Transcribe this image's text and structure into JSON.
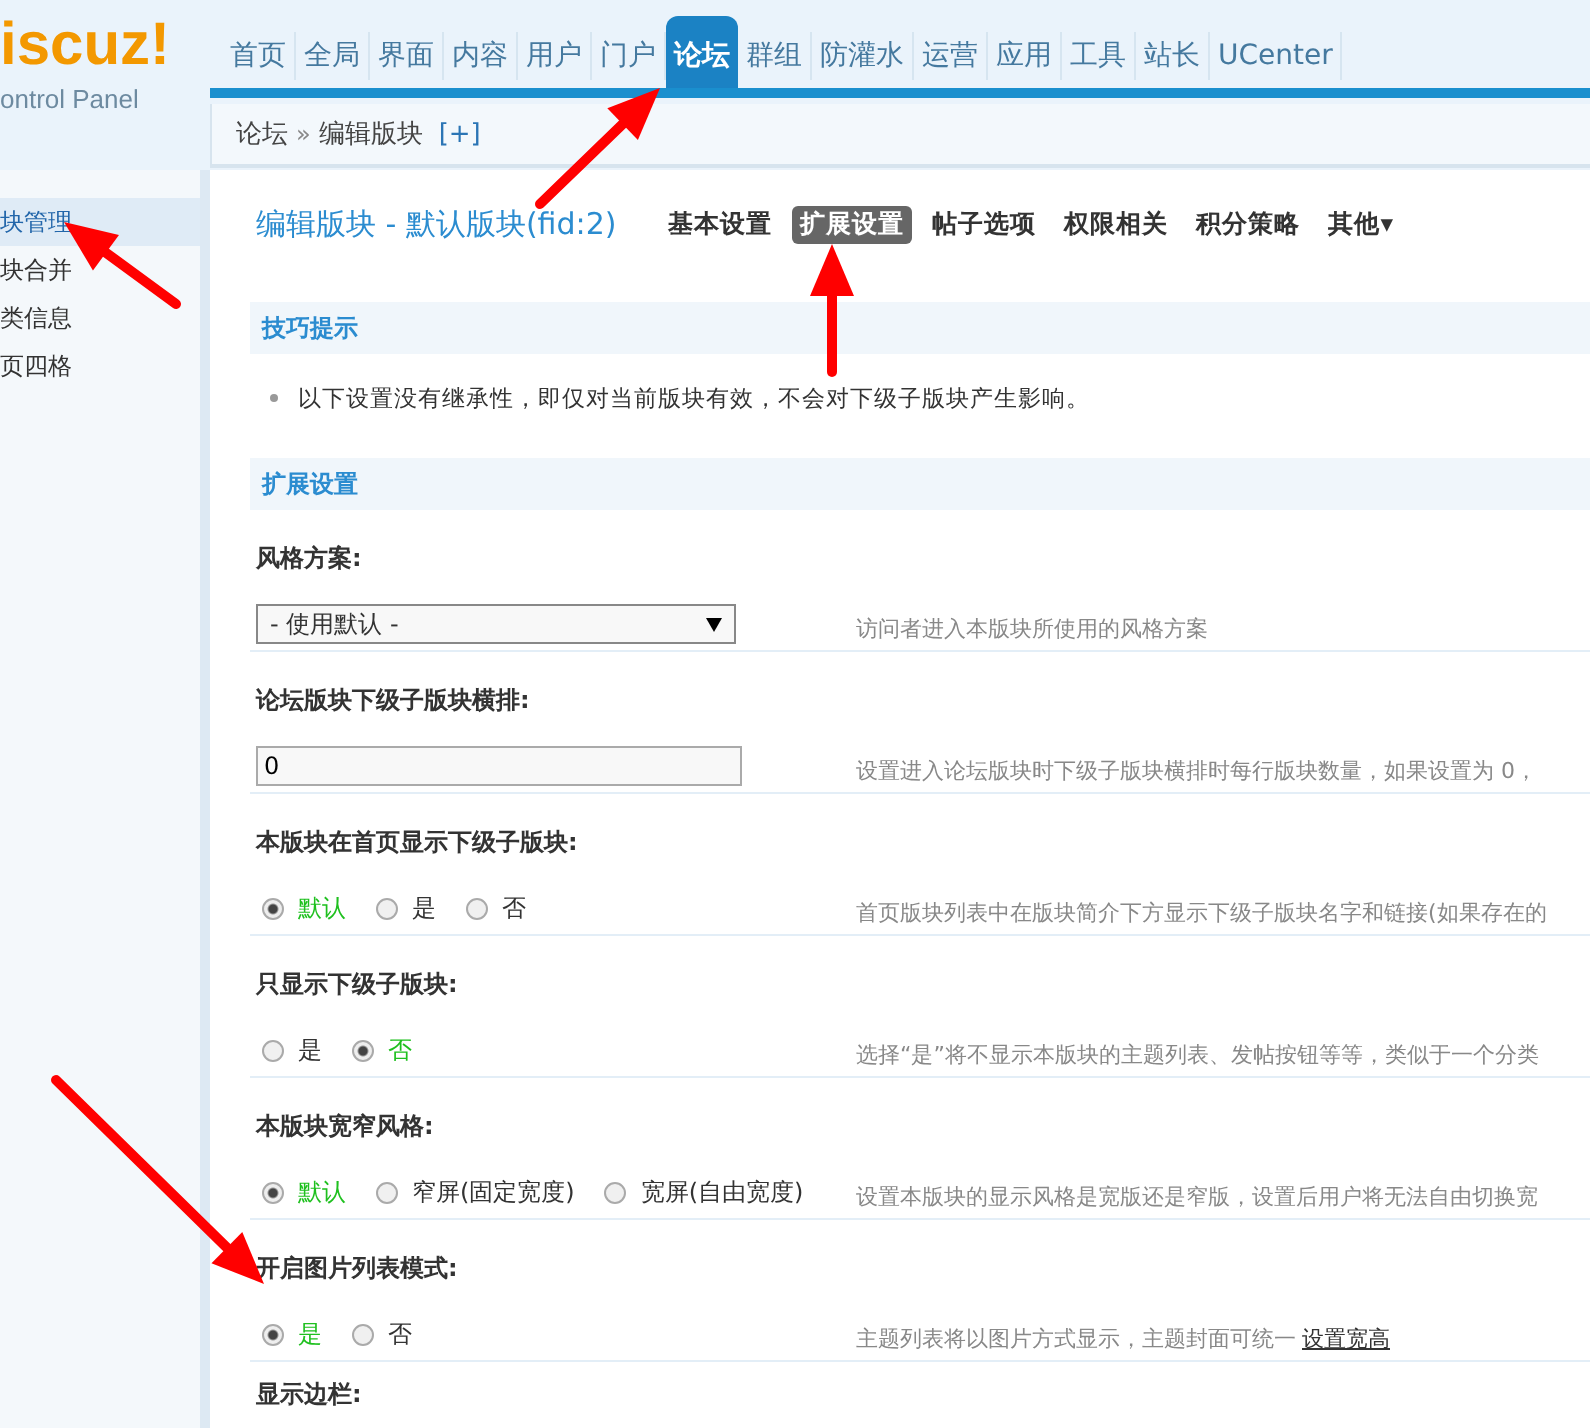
{
  "logo": {
    "title": "iscuz!",
    "subtitle": "ontrol Panel"
  },
  "nav": [
    {
      "label": "首页",
      "selected": false
    },
    {
      "label": "全局",
      "selected": false
    },
    {
      "label": "界面",
      "selected": false
    },
    {
      "label": "内容",
      "selected": false
    },
    {
      "label": "用户",
      "selected": false
    },
    {
      "label": "门户",
      "selected": false
    },
    {
      "label": "论坛",
      "selected": true
    },
    {
      "label": "群组",
      "selected": false
    },
    {
      "label": "防灌水",
      "selected": false
    },
    {
      "label": "运营",
      "selected": false
    },
    {
      "label": "应用",
      "selected": false
    },
    {
      "label": "工具",
      "selected": false
    },
    {
      "label": "站长",
      "selected": false
    },
    {
      "label": "UCenter",
      "selected": false
    }
  ],
  "breadcrumb": {
    "root": "论坛",
    "separator": "»",
    "current": "编辑版块",
    "add": "[+]"
  },
  "sidebar": {
    "items": [
      {
        "label": "块管理",
        "selected": true
      },
      {
        "label": "块合并",
        "selected": false
      },
      {
        "label": "类信息",
        "selected": false
      },
      {
        "label": "页四格",
        "selected": false
      }
    ]
  },
  "page_title": "编辑版块 - 默认版块(fid:2)",
  "tabs": [
    {
      "label": "基本设置",
      "selected": false
    },
    {
      "label": "扩展设置",
      "selected": true
    },
    {
      "label": "帖子选项",
      "selected": false
    },
    {
      "label": "权限相关",
      "selected": false
    },
    {
      "label": "积分策略",
      "selected": false
    },
    {
      "label": "其他▾",
      "selected": false
    }
  ],
  "tips": {
    "title": "技巧提示",
    "items": [
      "以下设置没有继承性，即仅对当前版块有效，不会对下级子版块产生影响。"
    ]
  },
  "section_title": "扩展设置",
  "settings": [
    {
      "kind": "select",
      "label": "风格方案:",
      "value": "- 使用默认 -",
      "description": "访问者进入本版块所使用的风格方案"
    },
    {
      "kind": "text",
      "label": "论坛版块下级子版块横排:",
      "value": "0",
      "description": "设置进入论坛版块时下级子版块横排时每行版块数量，如果设置为 0，"
    },
    {
      "kind": "radio",
      "label": "本版块在首页显示下级子版块:",
      "options": [
        {
          "label": "默认",
          "selected": true
        },
        {
          "label": "是",
          "selected": false
        },
        {
          "label": "否",
          "selected": false
        }
      ],
      "description": "首页版块列表中在版块简介下方显示下级子版块名字和链接(如果存在的"
    },
    {
      "kind": "radio",
      "label": "只显示下级子版块:",
      "options": [
        {
          "label": "是",
          "selected": false
        },
        {
          "label": "否",
          "selected": true
        }
      ],
      "description": "选择“是”将不显示本版块的主题列表、发帖按钮等等，类似于一个分类"
    },
    {
      "kind": "radio",
      "label": "本版块宽窄风格:",
      "options": [
        {
          "label": "默认",
          "selected": true
        },
        {
          "label": "窄屏(固定宽度)",
          "selected": false
        },
        {
          "label": "宽屏(自由宽度)",
          "selected": false
        }
      ],
      "description": "设置本版块的显示风格是宽版还是窄版，设置后用户将无法自由切换宽"
    },
    {
      "kind": "radio",
      "label": "开启图片列表模式:",
      "options": [
        {
          "label": "是",
          "selected": true
        },
        {
          "label": "否",
          "selected": false
        }
      ],
      "description": "主题列表将以图片方式显示，主题封面可统一",
      "link": "设置宽高"
    },
    {
      "kind": "heading",
      "label": "显示边栏:"
    }
  ]
}
